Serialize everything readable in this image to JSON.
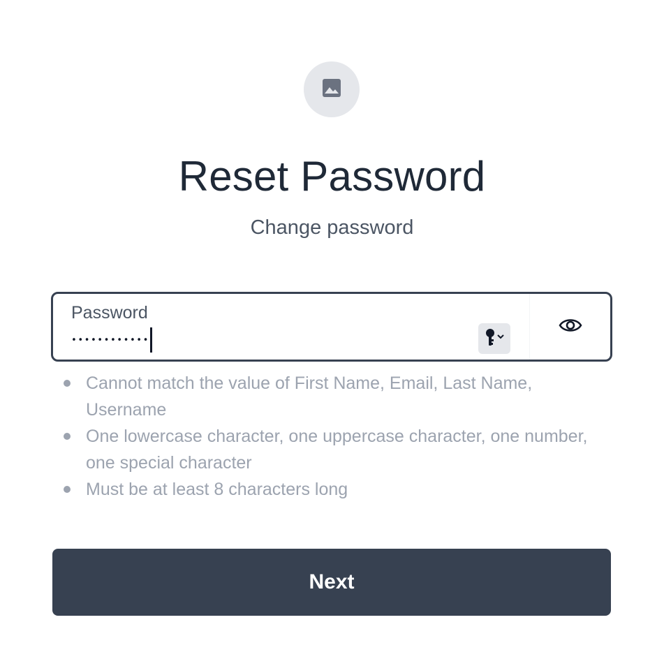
{
  "header": {
    "avatar_icon": "image-placeholder-icon",
    "title": "Reset Password",
    "subtitle": "Change password"
  },
  "password_field": {
    "label": "Password",
    "masked_value": "••••••••••••",
    "password_manager_icon": "key-dropdown-icon",
    "toggle_icon": "eye-icon"
  },
  "requirements": [
    "Cannot match the value of First Name, Email, Last Name, Username",
    "One lowercase character, one uppercase character, one number, one special character",
    "Must be at least 8 characters long"
  ],
  "actions": {
    "next_label": "Next"
  },
  "colors": {
    "primary": "#374151",
    "muted_text": "#9ca3af",
    "avatar_bg": "#e5e7eb"
  }
}
